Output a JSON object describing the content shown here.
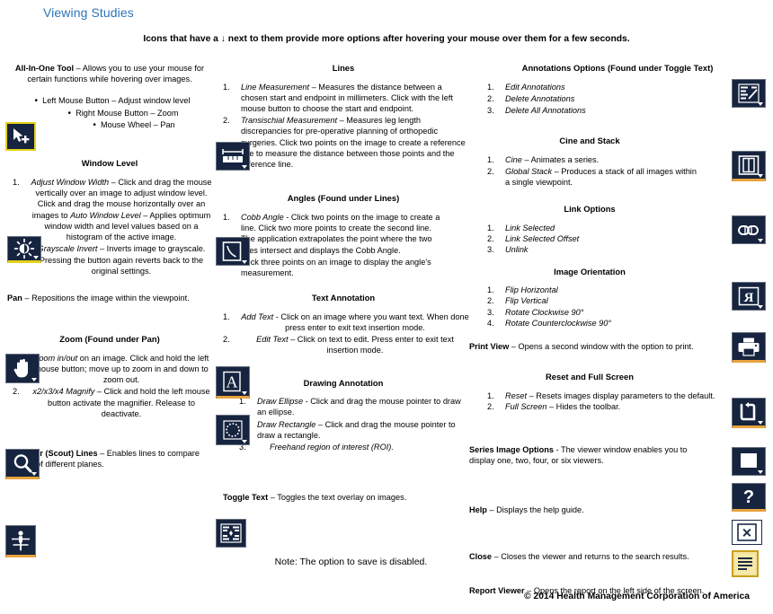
{
  "document": {
    "title": "Viewing Studies",
    "subtitle_before": "Icons that have a ",
    "subtitle_arrow": "↓",
    "subtitle_after": " next to them provide more options after hovering your mouse over them for a few seconds.",
    "footer": "© 2014 Health Management Corporation of America",
    "note": "Note: The option to save is disabled.",
    "accent_blue": "#2E74B5",
    "icon_navy": "#16243f",
    "icon_yellow": "#e3d21a",
    "icon_orange": "#e8a33d"
  },
  "left_column": {
    "all_in_one": {
      "term": "All-In-One Tool",
      "text": " – Allows you to use your mouse for certain functions while hovering over images.",
      "bullets": [
        "Left Mouse Button – Adjust window level",
        "Right Mouse Button – Zoom",
        "Mouse Wheel – Pan"
      ],
      "icon": "all-in-one-cursor-icon"
    },
    "window_level": {
      "heading": "Window Level",
      "items": [
        {
          "ital": "Adjust Window Width",
          "rest": " – Click and drag the mouse vertically over an image to adjust window level. Click and drag the mouse horizontally over an images to ",
          "ital2": "Auto Window Level",
          "rest2": " – Applies optimum window width and level values based on a histogram of the active image."
        },
        {
          "ital": "Grayscale Invert",
          "rest": " – Inverts image to grayscale. Pressing the button again reverts back to the original settings."
        }
      ],
      "icon": "window-level-brightness-icon"
    },
    "pan": {
      "term": "Pan",
      "text": " – Repositions the image within the viewpoint.",
      "icon": "pan-hand-icon"
    },
    "zoom": {
      "heading": "Zoom (Found under Pan)",
      "items": [
        {
          "ital": "Zoom in/out",
          "rest": " on an image. Click and hold the left mouse button; move up to zoom in and down to zoom out."
        },
        {
          "ital": "x2/x3/x4 Magnify",
          "rest": " – Click and hold the left mouse button activate the magnifier. Release to deactivate."
        }
      ],
      "icon": "zoom-magnifier-icon"
    },
    "localizer": {
      "term": "Localizer (Scout) Lines",
      "text": " – Enables lines to compare images of different planes.",
      "icon": "localizer-scout-lines-icon"
    }
  },
  "mid_column": {
    "lines": {
      "heading": "Lines",
      "items": [
        {
          "ital": "Line Measurement",
          "rest": " – Measures the distance between a chosen start and endpoint in millimeters. Click with the left mouse button to choose the start and endpoint."
        },
        {
          "ital": "Transischial Measurement",
          "rest": " – Measures leg length discrepancies for pre-operative planning of orthopedic surgeries. Click two points on the image to create a reference line to measure the distance between those points and the reference line."
        }
      ],
      "icon": "line-measurement-icon"
    },
    "angles": {
      "heading": "Angles (Found under Lines)",
      "items": [
        {
          "ital": "Cobb Angle",
          "rest": " - Click two points on the image to create a line. Click two more points to create the second line. The application extrapolates the point where the two lines intersect and displays the Cobb Angle."
        },
        {
          "ital": "",
          "rest": "Click three points on an image to display the angle’s measurement."
        }
      ],
      "icon": "cobb-angle-icon"
    },
    "text_annotation": {
      "heading": "Text Annotation",
      "items": [
        {
          "ital": "Add Text",
          "rest": " - Click on an image where you want text. When done press enter to exit text insertion mode."
        },
        {
          "ital": "Edit Text",
          "rest": " – Click on text to edit. Press enter to exit text insertion mode."
        }
      ],
      "icon": "text-annotation-a-icon"
    },
    "drawing_annotation": {
      "heading": "Drawing Annotation",
      "items": [
        {
          "ital": "Draw Ellipse",
          "rest": " - Click and drag the mouse pointer to draw an ellipse."
        },
        {
          "ital": "Draw Rectangle",
          "rest": " – Click and drag the mouse pointer to draw a rectangle."
        },
        {
          "ital": "Freehand region of interest (ROI).",
          "rest": ""
        }
      ],
      "icon": "draw-ellipse-icon"
    },
    "toggle_text": {
      "term": "Toggle Text",
      "text": " – Toggles the text overlay on images.",
      "icon": "toggle-text-icon"
    }
  },
  "right_column": {
    "annotations_options": {
      "heading": "Annotations Options (Found under Toggle Text)",
      "items": [
        "Edit Annotations",
        "Delete Annotations",
        "Delete All Annotations"
      ],
      "icon": "annotations-options-icon"
    },
    "cine_and_stack": {
      "heading": "Cine and Stack",
      "items": [
        {
          "ital": "Cine",
          "rest": " – Animates a series."
        },
        {
          "ital": "Global Stack",
          "rest": " – Produces a stack of all images within a single viewpoint."
        }
      ],
      "icon": "cine-stack-icon"
    },
    "link_options": {
      "heading": "Link Options",
      "items": [
        "Link Selected",
        "Link Selected Offset",
        "Unlink"
      ],
      "icon": "link-chain-icon"
    },
    "image_orientation": {
      "heading": "Image Orientation",
      "items": [
        "Flip Horizontal",
        "Flip Vertical",
        "Rotate Clockwise 90°",
        "Rotate Counterclockwise 90°"
      ],
      "icon": "image-orientation-flip-icon"
    },
    "print_view": {
      "term": "Print View",
      "text": " – Opens a second window with the option to print.",
      "icon": "print-view-printer-icon"
    },
    "reset_full_screen": {
      "heading": "Reset and Full Screen",
      "items": [
        {
          "ital": "Reset",
          "rest": " – Resets images display parameters to the default."
        },
        {
          "ital": "Full Screen",
          "rest": " – Hides the toolbar."
        }
      ],
      "icon": "reset-full-screen-icon"
    },
    "series_image_options": {
      "term": "Series Image Options",
      "text": " - The viewer window enables you to display one, two, four, or six viewers.",
      "icon": "series-image-options-icon"
    },
    "help": {
      "term": "Help",
      "text": " – Displays the help guide.",
      "icon": "help-question-icon"
    },
    "close": {
      "term": "Close",
      "text": " – Closes the viewer and returns to the search results.",
      "icon": "close-x-icon"
    },
    "report_viewer": {
      "term": "Report Viewer",
      "text": " – Opens the report on the left side of the screen.",
      "icon": "report-viewer-icon"
    }
  }
}
